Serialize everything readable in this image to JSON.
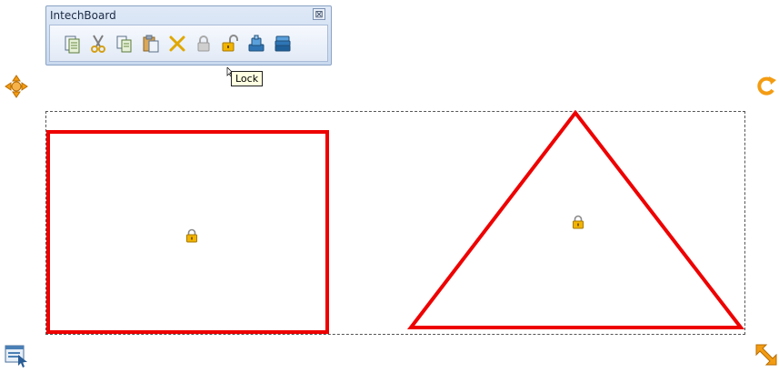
{
  "toolbar": {
    "title": "IntechBoard",
    "close_label": "⊠",
    "buttons": [
      {
        "name": "new-page-icon"
      },
      {
        "name": "cut-icon"
      },
      {
        "name": "copy-icon"
      },
      {
        "name": "paste-icon"
      },
      {
        "name": "delete-icon"
      },
      {
        "name": "lock-icon"
      },
      {
        "name": "unlock-icon"
      },
      {
        "name": "bring-to-front-icon"
      },
      {
        "name": "send-to-back-icon"
      }
    ]
  },
  "tooltip": {
    "text": "Lock"
  },
  "canvas": {
    "shape_color": "#ee0000",
    "shapes": [
      {
        "type": "rectangle",
        "locked": true
      },
      {
        "type": "triangle",
        "locked": true
      }
    ]
  },
  "handles": {
    "move": "move-handle-icon",
    "rotate": "rotate-handle-icon",
    "menu": "context-menu-handle-icon",
    "resize": "resize-handle-icon"
  }
}
